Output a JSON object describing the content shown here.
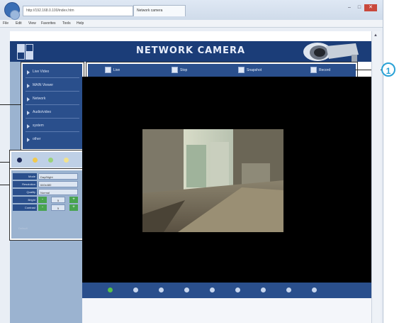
{
  "browser": {
    "address": "http://192.168.0.100/index.htm",
    "tab_title": "Network camera",
    "menu": [
      "File",
      "Edit",
      "View",
      "Favorites",
      "Tools",
      "Help"
    ],
    "controls": {
      "minimize": "–",
      "maximize": "□",
      "close": "✕"
    }
  },
  "header": {
    "title": "NETWORK CAMERA"
  },
  "left_menu": [
    "Live Video",
    "MAIN Viewer",
    "Network",
    "Audio/video",
    "system",
    "other"
  ],
  "toolbar": [
    "Live",
    "Stop",
    "Snapshot",
    "Record"
  ],
  "zoom": {
    "dots": [
      "#1e2a5a",
      "#f2c94c",
      "#9ad27a",
      "#f2e28c"
    ]
  },
  "settings": {
    "rows": [
      {
        "label": "Mode",
        "value": "Day/Night"
      },
      {
        "label": "Resolution",
        "value": "640x480"
      },
      {
        "label": "Quality",
        "value": "Normal"
      }
    ],
    "adjust": [
      {
        "label": "Bright",
        "value": "5",
        "minus": "-",
        "plus": "+"
      },
      {
        "label": "Contrast",
        "value": "5",
        "minus": "-",
        "plus": "+"
      }
    ],
    "hint": "Default"
  },
  "callout": {
    "number": "1"
  },
  "channels": {
    "count": 9,
    "active_index": 0
  },
  "scroll": {
    "up": "▲"
  },
  "colors": {
    "header": "#1b3d78",
    "sidebar": "#9bb3d0",
    "menu": "#2a4f8c",
    "active": "#57c14a",
    "callout": "#2aa2d6"
  }
}
